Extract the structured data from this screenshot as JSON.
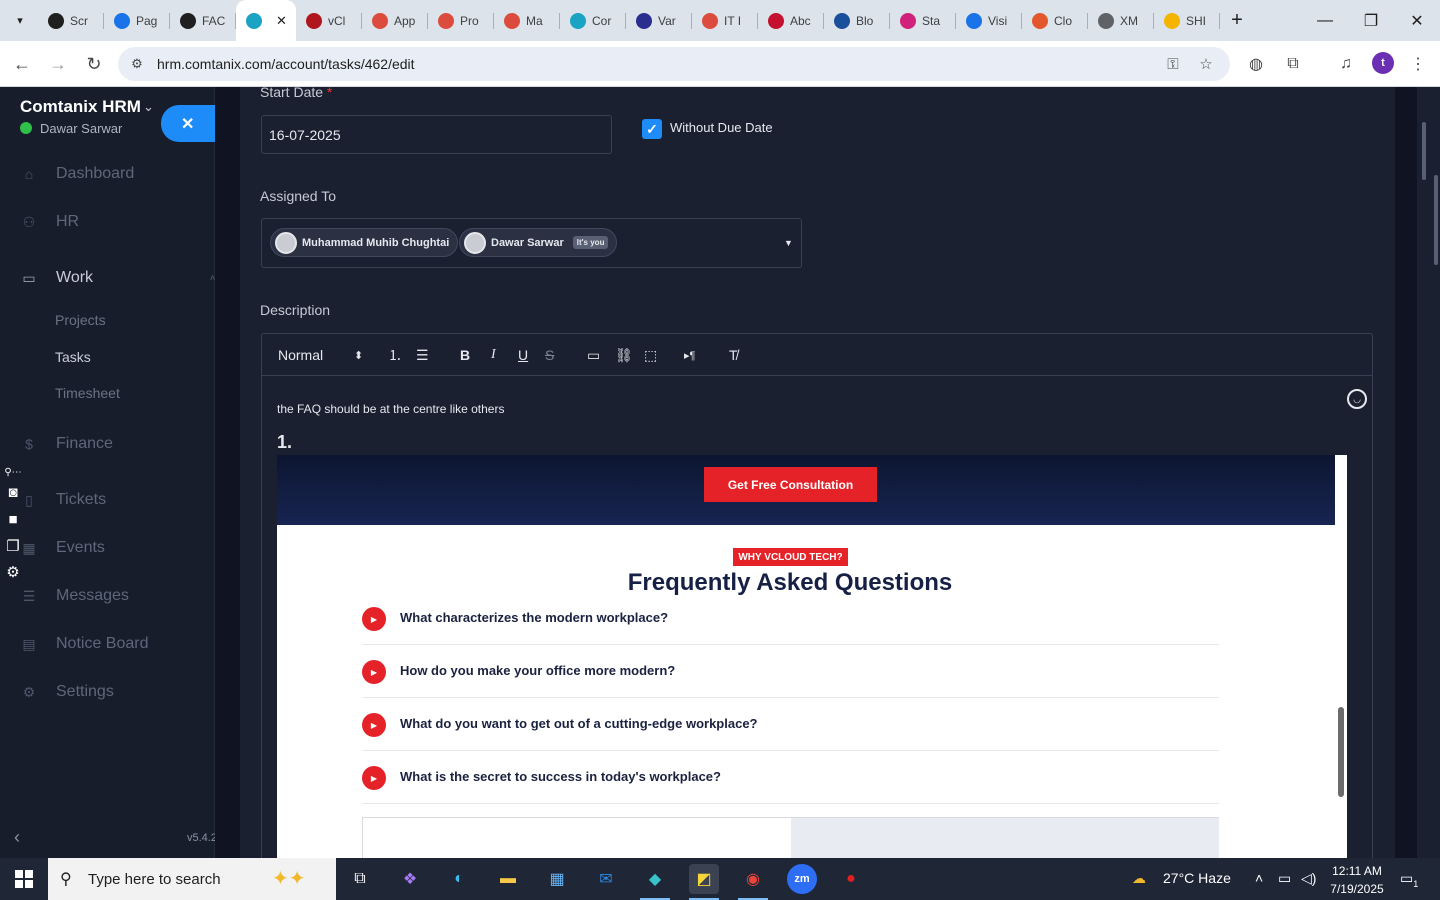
{
  "browser": {
    "tabs": [
      {
        "label": "Scr",
        "icon": "screenpresso-icon",
        "color": "#1f1f1f"
      },
      {
        "label": "Pag",
        "icon": "pagespeed-icon",
        "color": "#1a73e8"
      },
      {
        "label": "FAC",
        "icon": "faq-icon",
        "color": "#1f1f1f"
      },
      {
        "label": "",
        "icon": "crm-icon",
        "color": "#1aa3c2",
        "active": true
      },
      {
        "label": "vCl",
        "icon": "vcloud-icon",
        "color": "#b0161d"
      },
      {
        "label": "App",
        "icon": "todoist-icon",
        "color": "#db4c3f"
      },
      {
        "label": "Pro",
        "icon": "todoist-icon",
        "color": "#db4c3f"
      },
      {
        "label": "Ma",
        "icon": "todoist-icon",
        "color": "#db4c3f"
      },
      {
        "label": "Cor",
        "icon": "crm-icon",
        "color": "#1aa3c2"
      },
      {
        "label": "Var",
        "icon": "x-icon",
        "color": "#2a2f8f"
      },
      {
        "label": "IT I",
        "icon": "todoist-icon",
        "color": "#db4c3f"
      },
      {
        "label": "Abc",
        "icon": "app-icon",
        "color": "#c4112f"
      },
      {
        "label": "Blo",
        "icon": "blog-icon",
        "color": "#1a4f9c"
      },
      {
        "label": "Sta",
        "icon": "pen-icon",
        "color": "#d0227a"
      },
      {
        "label": "Visi",
        "icon": "analytics-icon",
        "color": "#1a73e8"
      },
      {
        "label": "Clo",
        "icon": "clockify-icon",
        "color": "#e4572e"
      },
      {
        "label": "XM",
        "icon": "globe-icon",
        "color": "#5f6368"
      },
      {
        "label": "SHI",
        "icon": "shield-icon",
        "color": "#f4b400"
      }
    ],
    "url": "hrm.comtanix.com/account/tasks/462/edit",
    "profile_initial": "t"
  },
  "sidebar": {
    "brand": "Comtanix HRM",
    "user_name": "Dawar Sarwar",
    "menu": [
      {
        "label": "Dashboard",
        "icon": "home-icon"
      },
      {
        "label": "HR",
        "icon": "people-icon"
      },
      {
        "label": "Work",
        "icon": "briefcase-icon",
        "open": true
      },
      {
        "label": "Finance",
        "icon": "dollar-icon"
      },
      {
        "label": "Tickets",
        "icon": "ticket-icon"
      },
      {
        "label": "Events",
        "icon": "calendar-icon"
      },
      {
        "label": "Messages",
        "icon": "message-icon"
      },
      {
        "label": "Notice Board",
        "icon": "clipboard-icon"
      },
      {
        "label": "Settings",
        "icon": "gear-icon"
      }
    ],
    "work_submenu": [
      "Projects",
      "Tasks",
      "Timesheet"
    ],
    "active_submenu": "Tasks",
    "version": "v5.4.2"
  },
  "form": {
    "start_date_label": "Start Date",
    "start_date_required": "*",
    "start_date_value": "16-07-2025",
    "without_due_date_label": "Without Due Date",
    "without_due_date_checked": true,
    "assigned_to_label": "Assigned To",
    "assignees": [
      {
        "name": "Muhammad Muhib Chughtai"
      },
      {
        "name": "Dawar Sarwar",
        "badge": "It's you"
      }
    ],
    "description_label": "Description",
    "editor": {
      "format_select": "Normal",
      "body_text": "the FAQ should be at the centre like others",
      "list_number": "1."
    }
  },
  "embedded_image": {
    "cta_label": "Get Free Consultation",
    "tag": "WHY VCLOUD TECH?",
    "title": "Frequently Asked Questions",
    "questions": [
      "What characterizes the modern workplace?",
      "How do you make your office more modern?",
      "What do you want to get out of a cutting-edge workplace?",
      "What is the secret to success in today's workplace?"
    ],
    "accent_color": "#e42228",
    "navy_color": "#152044"
  },
  "taskbar": {
    "search_placeholder": "Type here to search",
    "weather": "27°C  Haze",
    "time": "12:11 AM",
    "date": "7/19/2025",
    "notification_count": "1"
  }
}
